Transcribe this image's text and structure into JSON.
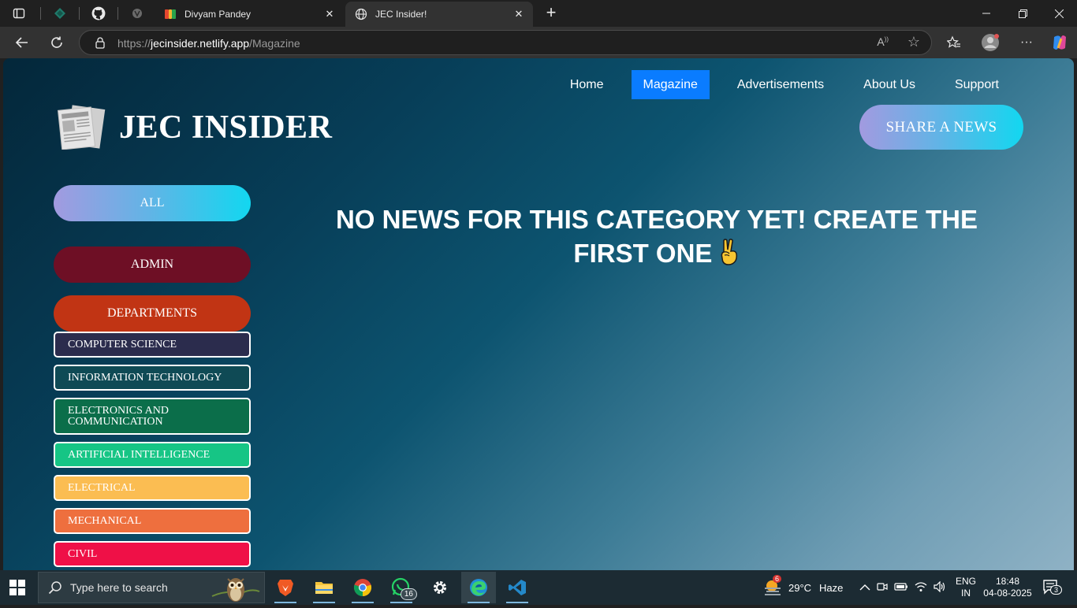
{
  "browser": {
    "tabs": [
      {
        "title": "Divyam Pandey",
        "active": false
      },
      {
        "title": "JEC Insider!",
        "active": true
      }
    ],
    "url_prefix": "https://",
    "url_host": "jecinsider.netlify.app",
    "url_path": "/Magazine"
  },
  "site": {
    "brand": "JEC INSIDER",
    "nav": [
      {
        "label": "Home",
        "active": false
      },
      {
        "label": "Magazine",
        "active": true
      },
      {
        "label": "Advertisements",
        "active": false
      },
      {
        "label": "About Us",
        "active": false
      },
      {
        "label": "Support",
        "active": false
      }
    ],
    "share_label": "SHARE A NEWS",
    "categories": {
      "all": "ALL",
      "admin": "ADMIN",
      "departments": "DEPARTMENTS",
      "department_items": [
        {
          "label": "COMPUTER SCIENCE",
          "color": "#2b2c4d"
        },
        {
          "label": "INFORMATION TECHNOLOGY",
          "color": "#0f4a55"
        },
        {
          "label": "ELECTRONICS AND COMMUNICATION",
          "color": "#0b6e4a"
        },
        {
          "label": "ARTIFICIAL INTELLIGENCE",
          "color": "#16c585"
        },
        {
          "label": "ELECTRICAL",
          "color": "#fbbd52"
        },
        {
          "label": "MECHANICAL",
          "color": "#ee6f3e"
        },
        {
          "label": "CIVIL",
          "color": "#ef1047"
        }
      ]
    },
    "empty_message": "NO NEWS FOR THIS CATEGORY YET! CREATE THE FIRST ONE",
    "empty_emoji": "✌"
  },
  "taskbar": {
    "search_placeholder": "Type here to search",
    "whatsapp_badge": "16",
    "weather_badge": "6",
    "temperature": "29°C",
    "condition": "Haze",
    "lang_top": "ENG",
    "lang_bottom": "IN",
    "time": "18:48",
    "date": "04-08-2025",
    "notifications": "3"
  },
  "colors": {
    "nav_active": "#0a7cff",
    "admin": "#6e0f25",
    "departments": "#c13414"
  }
}
